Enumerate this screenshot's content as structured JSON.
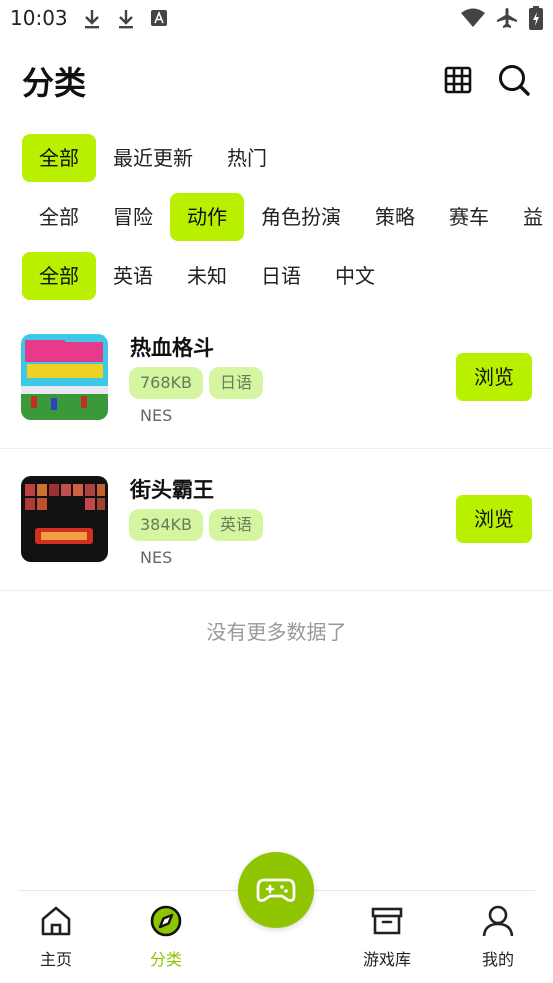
{
  "status_bar": {
    "time": "10:03"
  },
  "header": {
    "title": "分类"
  },
  "filters": {
    "sort": [
      "全部",
      "最近更新",
      "热门"
    ],
    "genre": [
      "全部",
      "冒险",
      "动作",
      "角色扮演",
      "策略",
      "赛车",
      "益"
    ],
    "language": [
      "全部",
      "英语",
      "未知",
      "日语",
      "中文"
    ]
  },
  "games": [
    {
      "name": "热血格斗",
      "size": "768KB",
      "language": "日语",
      "platform": "NES",
      "button": "浏览"
    },
    {
      "name": "街头霸王",
      "size": "384KB",
      "language": "英语",
      "platform": "NES",
      "button": "浏览"
    }
  ],
  "list_footer": "没有更多数据了",
  "tabbar": {
    "home": "主页",
    "category": "分类",
    "library": "游戏库",
    "mine": "我的"
  },
  "colors": {
    "accent": "#b8f000",
    "accent_dark": "#8fc400",
    "tag_bg": "#d5f5a0"
  }
}
